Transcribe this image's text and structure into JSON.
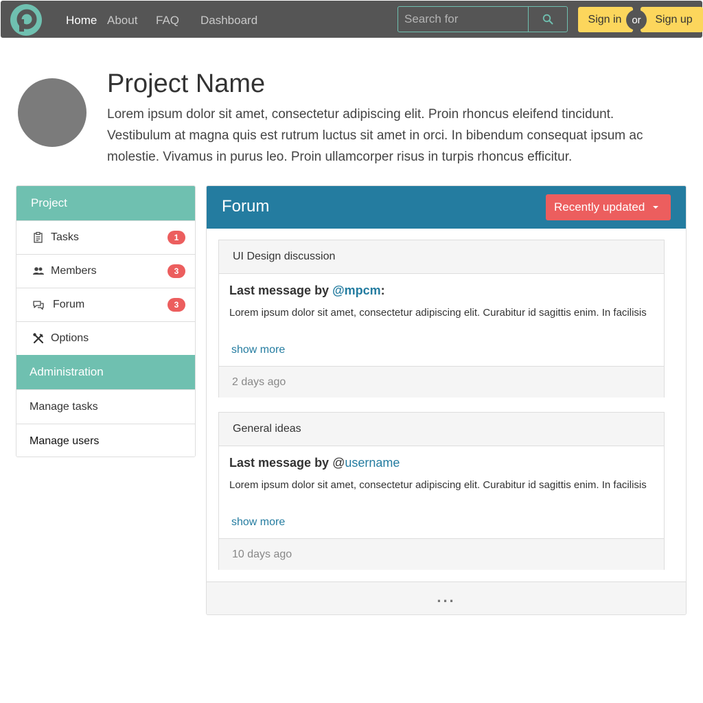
{
  "navbar": {
    "links": [
      "Home",
      "About",
      "FAQ",
      "Dashboard"
    ],
    "search_placeholder": "Search for",
    "signin_label": "Sign in",
    "or_label": "or",
    "signup_label": "Sign up"
  },
  "project": {
    "title": "Project Name",
    "description": "Lorem ipsum dolor sit amet, consectetur adipiscing elit. Proin rhoncus eleifend tincidunt. Vestibulum at magna quis est rutrum luctus sit amet in orci. In bibendum consequat ipsum ac molestie. Vivamus in purus leo. Proin ullamcorper risus in turpis rhoncus efficitur."
  },
  "sidebar": {
    "project_header": "Project",
    "items": [
      {
        "label": "Tasks",
        "icon": "clipboard-icon",
        "badge": "1"
      },
      {
        "label": "Members",
        "icon": "users-icon",
        "badge": "3"
      },
      {
        "label": "Forum",
        "icon": "chat-icon",
        "badge": "3"
      },
      {
        "label": "Options",
        "icon": "tools-icon"
      }
    ],
    "admin_header": "Administration",
    "admin_items": [
      "Manage tasks",
      "Manage users"
    ]
  },
  "forum": {
    "title": "Forum",
    "sort_label": "Recently updated",
    "topics": [
      {
        "title": "UI Design discussion",
        "last_prefix": "Last message by ",
        "at": "@",
        "user": "mpcm",
        "suffix": ":",
        "snippet": "Lorem ipsum dolor sit amet, consectetur adipiscing elit. Curabitur id sagittis enim. In facilisis",
        "show_more": "show more",
        "time": "2 days ago"
      },
      {
        "title": "General ideas",
        "last_prefix": "Last message by ",
        "at": "@",
        "user": "username",
        "suffix": "",
        "snippet": "Lorem ipsum dolor sit amet, consectetur adipiscing elit. Curabitur id sagittis enim. In facilisis",
        "show_more": "show more",
        "time": "10 days ago"
      }
    ],
    "more_label": "..."
  },
  "colors": {
    "navbar_bg": "#555555",
    "accent_teal": "#6fc0b0",
    "forum_blue": "#247ca0",
    "red": "#ec5e5e",
    "yellow": "#fcd65c"
  }
}
